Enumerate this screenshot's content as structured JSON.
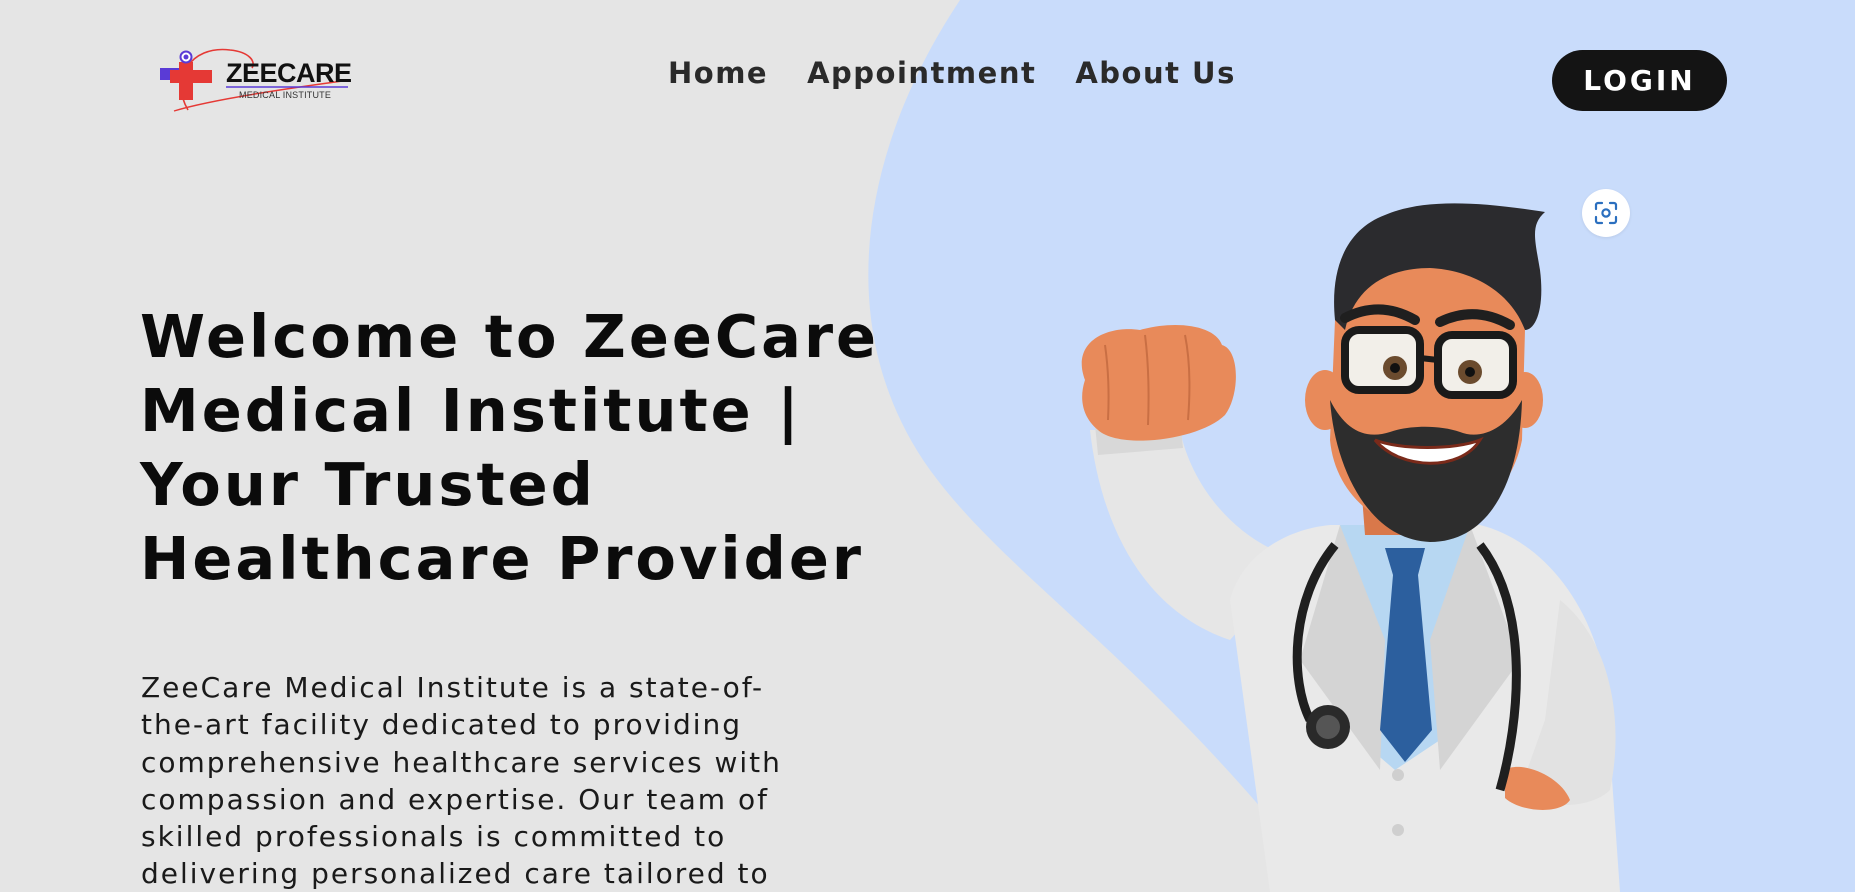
{
  "colors": {
    "page_background": "#e5e5e5",
    "blob": "#c9dcfb",
    "button": "#141414",
    "logo_red": "#e53935",
    "logo_purple": "#5a3bd6"
  },
  "logo": {
    "title": "ZEECARE",
    "subtitle": "MEDICAL INSTITUTE"
  },
  "nav": {
    "items": [
      {
        "label": "Home"
      },
      {
        "label": "Appointment"
      },
      {
        "label": "About Us"
      }
    ]
  },
  "header": {
    "login_label": "LOGIN",
    "scan_icon": "scan-focus-icon"
  },
  "hero": {
    "title_lines": [
      "Welcome to ZeeCare",
      "Medical Institute |",
      "Your Trusted",
      "Healthcare Provider"
    ],
    "description_lines": [
      "ZeeCare Medical Institute is a state-of-",
      "the-art facility dedicated to providing",
      "comprehensive healthcare services with",
      "compassion and expertise. Our team of",
      "skilled professionals is committed to",
      "delivering personalized care tailored to"
    ],
    "illustration": "cartoon-doctor-illustration"
  }
}
